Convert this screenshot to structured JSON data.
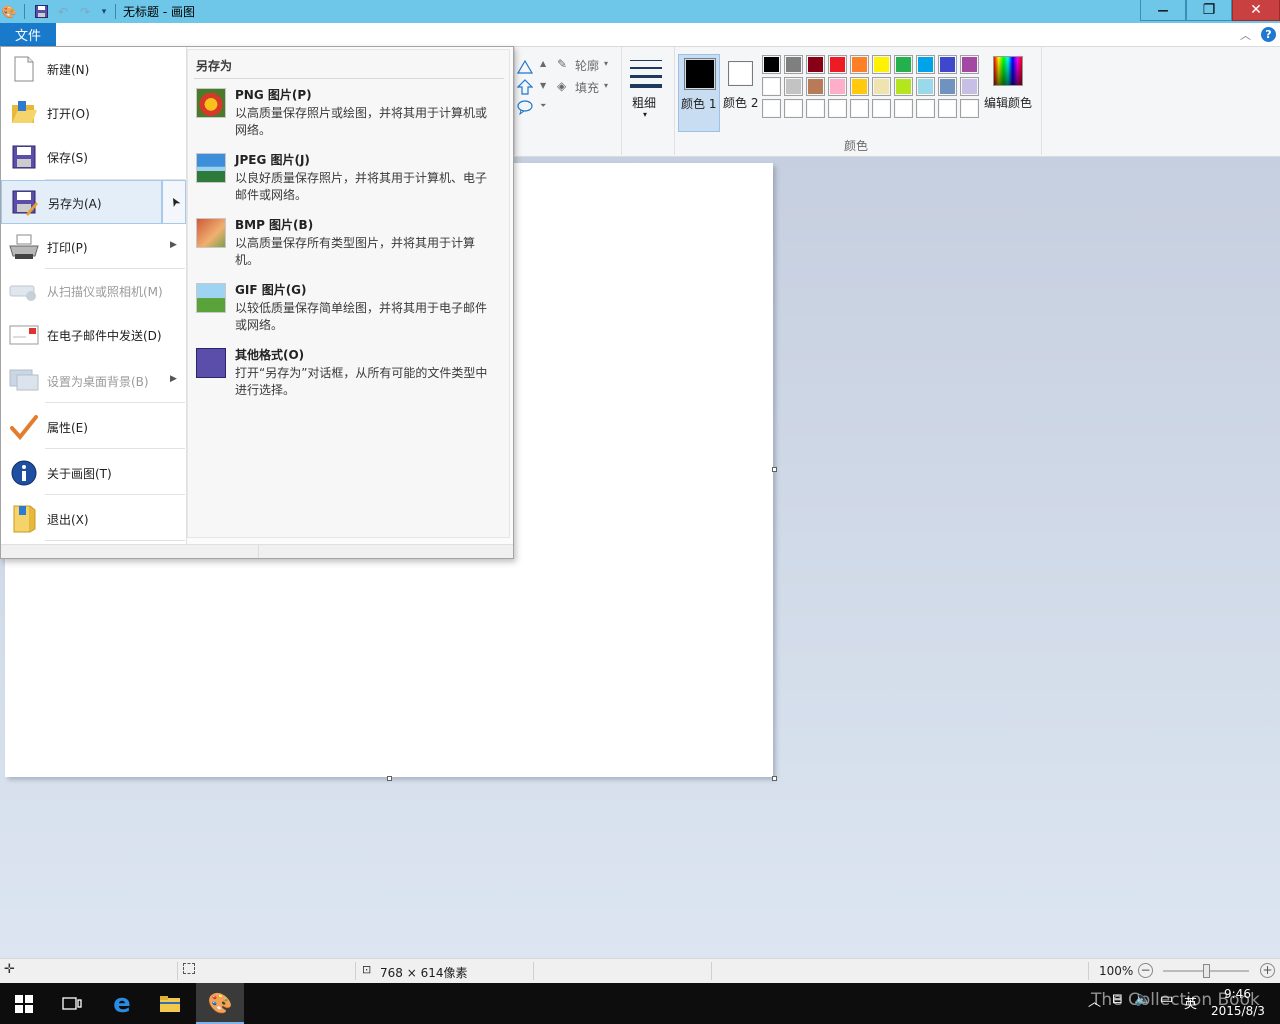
{
  "window": {
    "title": "无标题 - 画图",
    "minimize": "—",
    "restore": "❐",
    "close": "✕"
  },
  "ribbon": {
    "file_tab": "文件",
    "outline_label": "轮廓",
    "fill_label": "填充",
    "size_label": "粗细",
    "color1_label": "颜色 1",
    "color2_label": "颜色 2",
    "edit_colors_label": "编辑颜色",
    "colors_group_label": "颜色",
    "color1_value": "#000000",
    "color2_value": "#ffffff",
    "palette": [
      "#000000",
      "#7f7f7f",
      "#880015",
      "#ed1c24",
      "#ff7f27",
      "#fff200",
      "#22b14c",
      "#00a2e8",
      "#3f48cc",
      "#a349a4",
      "#ffffff",
      "#c3c3c3",
      "#b97a57",
      "#ffaec9",
      "#ffc90e",
      "#efe4b0",
      "#b5e61d",
      "#99d9ea",
      "#7092be",
      "#c8bfe7",
      "#ffffff",
      "#ffffff",
      "#ffffff",
      "#ffffff",
      "#ffffff",
      "#ffffff",
      "#ffffff",
      "#ffffff",
      "#ffffff",
      "#ffffff"
    ]
  },
  "file_menu": {
    "items": [
      {
        "label": "新建(N)",
        "icon": "new-file-icon",
        "enabled": true
      },
      {
        "label": "打开(O)",
        "icon": "open-folder-icon",
        "enabled": true
      },
      {
        "label": "保存(S)",
        "icon": "save-icon",
        "enabled": true
      },
      {
        "label": "另存为(A)",
        "icon": "save-as-icon",
        "enabled": true,
        "submenu": true,
        "active": true
      },
      {
        "label": "打印(P)",
        "icon": "printer-icon",
        "enabled": true,
        "submenu": true
      },
      {
        "label": "从扫描仪或照相机(M)",
        "icon": "scanner-icon",
        "enabled": false
      },
      {
        "label": "在电子邮件中发送(D)",
        "icon": "email-icon",
        "enabled": true
      },
      {
        "label": "设置为桌面背景(B)",
        "icon": "desktop-background-icon",
        "enabled": false,
        "submenu": true
      },
      {
        "label": "属性(E)",
        "icon": "checkmark-icon",
        "enabled": true
      },
      {
        "label": "关于画图(T)",
        "icon": "info-icon",
        "enabled": true
      },
      {
        "label": "退出(X)",
        "icon": "exit-icon",
        "enabled": true
      }
    ],
    "save_as": {
      "title": "另存为",
      "options": [
        {
          "title": "PNG 图片(P)",
          "desc": "以高质量保存照片或绘图，并将其用于计算机或网络。",
          "icon": "png-image-icon"
        },
        {
          "title": "JPEG 图片(J)",
          "desc": "以良好质量保存照片，并将其用于计算机、电子邮件或网络。",
          "icon": "jpeg-image-icon"
        },
        {
          "title": "BMP 图片(B)",
          "desc": "以高质量保存所有类型图片，并将其用于计算机。",
          "icon": "bmp-image-icon"
        },
        {
          "title": "GIF 图片(G)",
          "desc": "以较低质量保存简单绘图，并将其用于电子邮件或网络。",
          "icon": "gif-image-icon"
        },
        {
          "title": "其他格式(O)",
          "desc": "打开“另存为”对话框，从所有可能的文件类型中进行选择。",
          "icon": "other-formats-icon"
        }
      ]
    }
  },
  "statusbar": {
    "canvas_size": "768 × 614像素",
    "zoom": "100%",
    "zoom_fraction": 0.5
  },
  "taskbar": {
    "time": "9:46",
    "date": "2015/8/3",
    "ime": "英",
    "watermark": "The Collection Book"
  }
}
